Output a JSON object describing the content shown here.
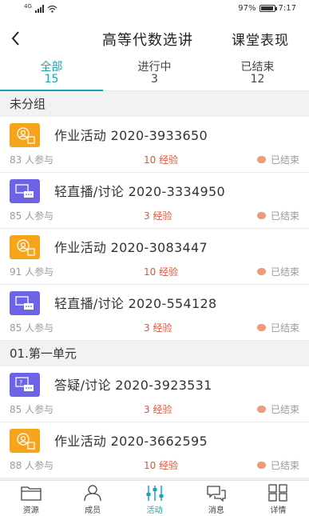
{
  "status_bar": {
    "network": "4G",
    "battery": "97%",
    "battery_level": 0.97,
    "time": "7:17"
  },
  "header": {
    "title": "高等代数选讲",
    "action": "课堂表现"
  },
  "tabs": [
    {
      "label": "全部",
      "count": "15"
    },
    {
      "label": "进行中",
      "count": "3"
    },
    {
      "label": "已结束",
      "count": "12"
    }
  ],
  "groups": [
    {
      "title": "未分组",
      "items": [
        {
          "icon": "task-icon",
          "name": "作业活动 2020-3933650",
          "participants": "83 人参与",
          "exp": "10 经验",
          "status": "已结束"
        },
        {
          "icon": "live-icon",
          "name": "轻直播/讨论 2020-3334950",
          "participants": "85 人参与",
          "exp": "3 经验",
          "status": "已结束"
        },
        {
          "icon": "task-icon",
          "name": "作业活动 2020-3083447",
          "participants": "91 人参与",
          "exp": "10 经验",
          "status": "已结束"
        },
        {
          "icon": "live-icon",
          "name": "轻直播/讨论 2020-554128",
          "participants": "85 人参与",
          "exp": "3 经验",
          "status": "已结束"
        }
      ]
    },
    {
      "title": "01.第一单元",
      "items": [
        {
          "icon": "qa-icon",
          "name": "答疑/讨论 2020-3923531",
          "participants": "85 人参与",
          "exp": "3 经验",
          "status": "已结束"
        },
        {
          "icon": "task-icon",
          "name": "作业活动 2020-3662595",
          "participants": "88 人参与",
          "exp": "10 经验",
          "status": "已结束"
        }
      ]
    }
  ],
  "bottom_nav": [
    {
      "label": "资源",
      "icon": "folder-icon"
    },
    {
      "label": "成员",
      "icon": "person-icon"
    },
    {
      "label": "活动",
      "icon": "activity-icon"
    },
    {
      "label": "消息",
      "icon": "chat-icon"
    },
    {
      "label": "详情",
      "icon": "grid-icon"
    }
  ],
  "colors": {
    "accent": "#1aa3b5",
    "task": "#f5a41b",
    "live": "#6c63e6",
    "exp": "#e0533a",
    "status_dot": "#ee9a7c"
  }
}
